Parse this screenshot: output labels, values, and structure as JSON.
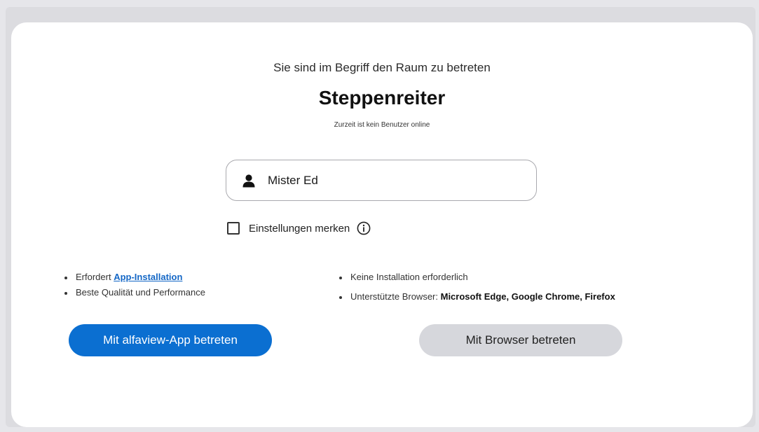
{
  "header": {
    "subtitle": "Sie sind im Begriff den Raum zu betreten",
    "room_name": "Steppenreiter",
    "online_status": "Zurzeit ist kein Benutzer online"
  },
  "name_field": {
    "value": "Mister Ed",
    "icon": "user-icon"
  },
  "remember": {
    "label": "Einstellungen merken",
    "checked": false,
    "icon": "info-icon"
  },
  "app_option": {
    "bullet_1_prefix": "Erfordert ",
    "bullet_1_link": "App-Installation",
    "bullet_2": "Beste Qualität und Performance",
    "button_label": "Mit alfaview-App betreten",
    "button_color": "#0b6fd1"
  },
  "browser_option": {
    "bullet_1": "Keine Installation erforderlich",
    "bullet_2_prefix": "Unterstützte Browser: ",
    "bullet_2_browsers": "Microsoft Edge, Google Chrome, Firefox",
    "button_label": "Mit Browser betreten",
    "button_color": "#d6d7dc"
  }
}
